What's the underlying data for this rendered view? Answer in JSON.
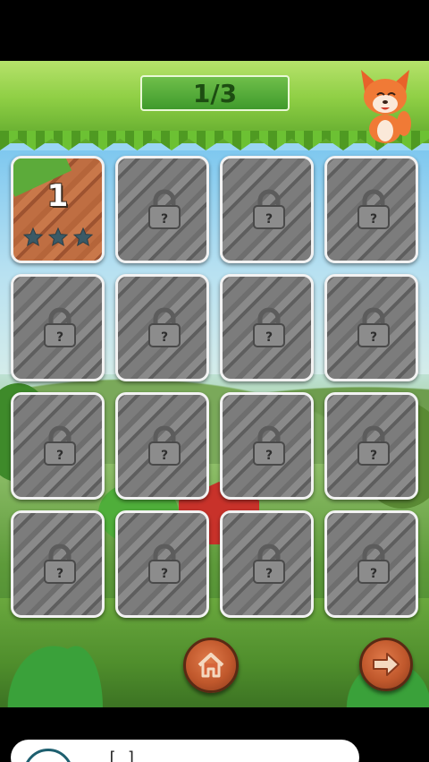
{
  "header": {
    "progress": "1/3"
  },
  "levels": [
    {
      "number": "1",
      "state": "unlocked",
      "stars": 3
    },
    {
      "state": "locked"
    },
    {
      "state": "locked"
    },
    {
      "state": "locked"
    },
    {
      "state": "locked"
    },
    {
      "state": "locked"
    },
    {
      "state": "locked"
    },
    {
      "state": "locked"
    },
    {
      "state": "locked"
    },
    {
      "state": "locked"
    },
    {
      "state": "locked"
    },
    {
      "state": "locked"
    },
    {
      "state": "locked"
    },
    {
      "state": "locked"
    },
    {
      "state": "locked"
    },
    {
      "state": "locked"
    }
  ],
  "lock_icon_symbol": "?",
  "buttons": {
    "home": "home-icon",
    "next": "arrow-right-icon"
  },
  "ad": {
    "text": "[ ]"
  },
  "colors": {
    "progress_bg": "#3f9a2c",
    "locked_tile": "#7a7a7a",
    "unlocked_tile": "#c9784a",
    "star": "#3a5a66",
    "button": "#c0582c"
  }
}
